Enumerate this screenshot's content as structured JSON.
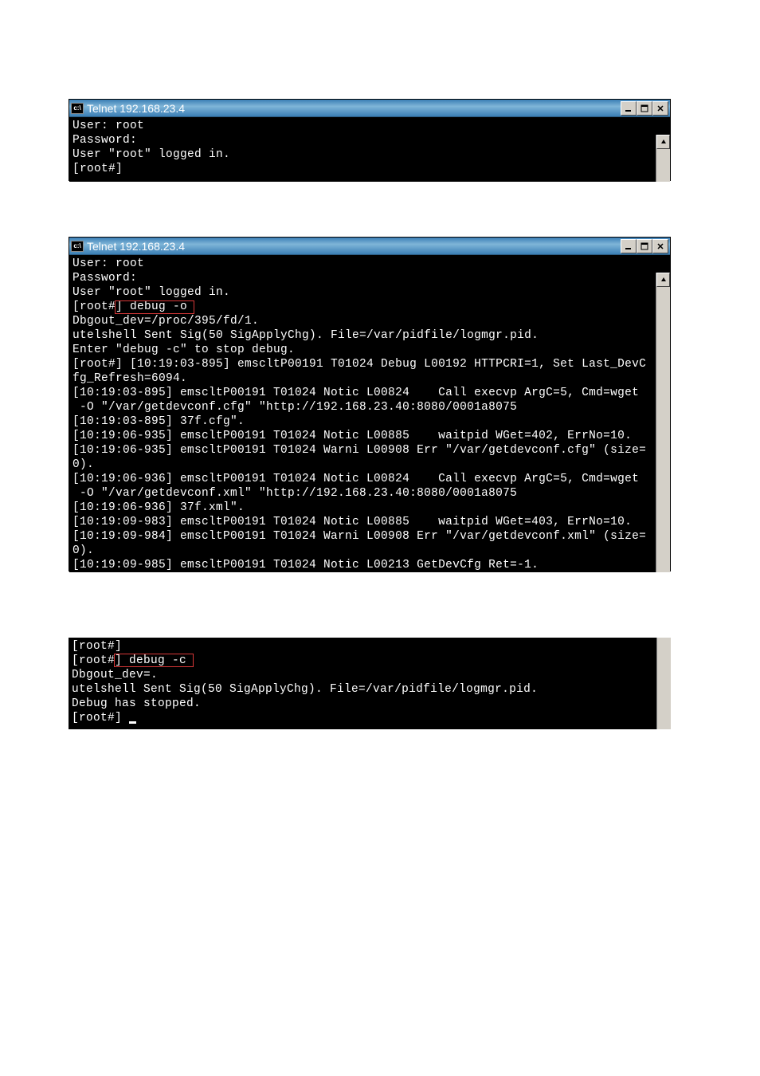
{
  "window1": {
    "icon_label": "c:\\",
    "title": "Telnet 192.168.23.4",
    "lines": [
      "User: root",
      "Password:",
      "User \"root\" logged in.",
      "[root#]"
    ]
  },
  "window2": {
    "icon_label": "c:\\",
    "title": "Telnet 192.168.23.4",
    "prefix_lines": [
      "User: root",
      "Password:",
      "User \"root\" logged in."
    ],
    "prompt_line_prefix": "[root#",
    "prompt_highlighted": "] debug -o ",
    "rest_lines": [
      "Dbgout_dev=/proc/395/fd/1.",
      "utelshell Sent Sig(50 SigApplyChg). File=/var/pidfile/logmgr.pid.",
      "Enter \"debug -c\" to stop debug.",
      "[root#] [10:19:03-895] emscltP00191 T01024 Debug L00192 HTTPCRI=1, Set Last_DevC",
      "fg_Refresh=6094.",
      "[10:19:03-895] emscltP00191 T01024 Notic L00824    Call execvp ArgC=5, Cmd=wget",
      " -O \"/var/getdevconf.cfg\" \"http://192.168.23.40:8080/0001a8075",
      "[10:19:03-895] 37f.cfg\".",
      "[10:19:06-935] emscltP00191 T01024 Notic L00885    waitpid WGet=402, ErrNo=10.",
      "[10:19:06-935] emscltP00191 T01024 Warni L00908 Err \"/var/getdevconf.cfg\" (size=",
      "0).",
      "[10:19:06-936] emscltP00191 T01024 Notic L00824    Call execvp ArgC=5, Cmd=wget",
      " -O \"/var/getdevconf.xml\" \"http://192.168.23.40:8080/0001a8075",
      "[10:19:06-936] 37f.xml\".",
      "[10:19:09-983] emscltP00191 T01024 Notic L00885    waitpid WGet=403, ErrNo=10.",
      "[10:19:09-984] emscltP00191 T01024 Warni L00908 Err \"/var/getdevconf.xml\" (size=",
      "0).",
      "[10:19:09-985] emscltP00191 T01024 Notic L00213 GetDevCfg Ret=-1."
    ]
  },
  "window3": {
    "line1": "[root#]",
    "prompt_line_prefix": "[root#",
    "prompt_highlighted": "] debug -c ",
    "rest_lines": [
      "Dbgout_dev=.",
      "utelshell Sent Sig(50 SigApplyChg). File=/var/pidfile/logmgr.pid.",
      "Debug has stopped.",
      "[root#] "
    ]
  }
}
